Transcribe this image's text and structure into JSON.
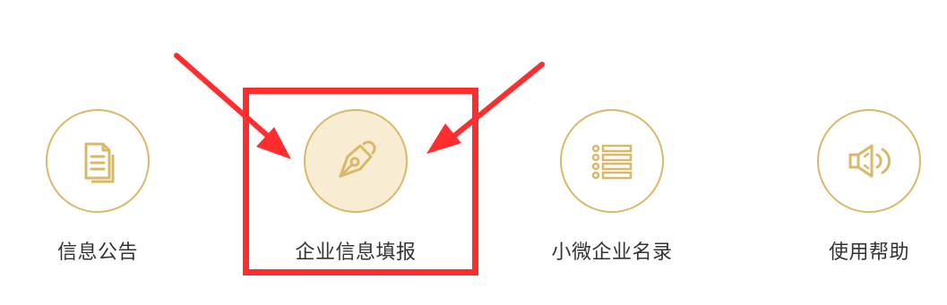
{
  "nav": {
    "items": [
      {
        "label": "信息公告",
        "icon": "document-icon",
        "active": false
      },
      {
        "label": "企业信息填报",
        "icon": "pen-nib-icon",
        "active": true
      },
      {
        "label": "小微企业名录",
        "icon": "list-icon",
        "active": false
      },
      {
        "label": "使用帮助",
        "icon": "speaker-icon",
        "active": false
      }
    ]
  },
  "colors": {
    "accent": "#d9b86a",
    "active_fill": "#f8ecd3",
    "highlight": "#ff2d2d",
    "label_text": "#333333"
  }
}
